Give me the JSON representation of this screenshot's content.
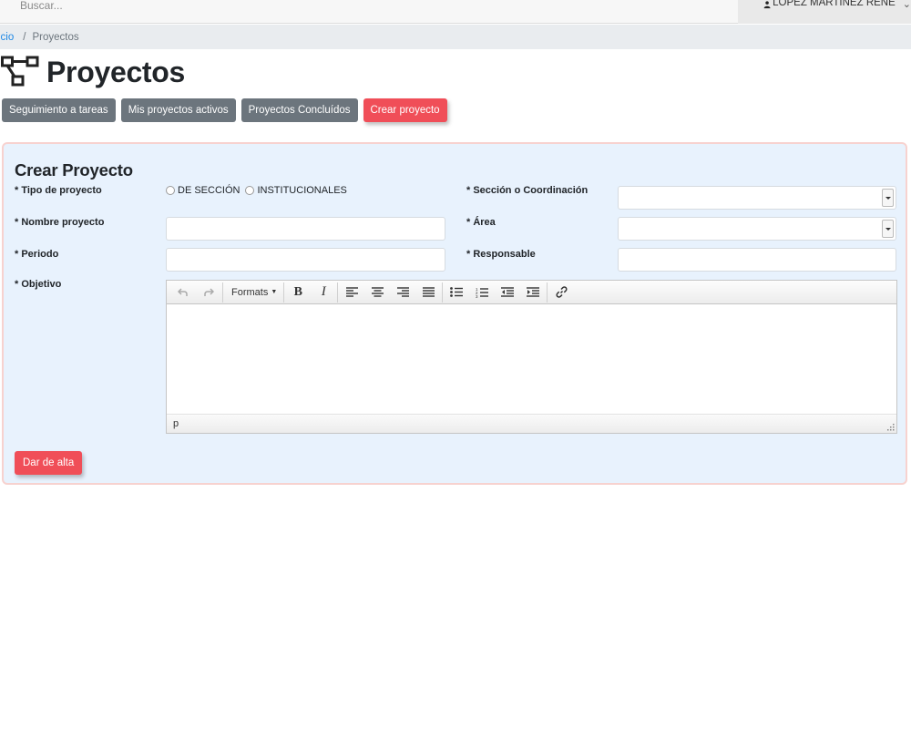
{
  "header": {
    "search_placeholder": "Buscar...",
    "user_name": "LOPEZ MARTINEZ RENE"
  },
  "breadcrumb": {
    "home": "icio",
    "separator": "/",
    "current": "Proyectos"
  },
  "page": {
    "title": "Proyectos"
  },
  "actions": [
    {
      "label": "Seguimiento a tareas",
      "style": "gray"
    },
    {
      "label": "Mis proyectos activos",
      "style": "gray"
    },
    {
      "label": "Proyectos Concluídos",
      "style": "gray"
    },
    {
      "label": "Crear proyecto",
      "style": "red"
    }
  ],
  "form": {
    "title": "Crear Proyecto",
    "labels": {
      "tipo": "* Tipo de proyecto",
      "nombre": "* Nombre proyecto",
      "periodo": "* Periodo",
      "objetivo": "* Objetivo",
      "seccion": "* Sección o Coordinación",
      "area": "* Área",
      "responsable": "* Responsable"
    },
    "radio_options": [
      "DE SECCIÓN",
      "INSTITUCIONALES"
    ],
    "values": {
      "nombre": "",
      "periodo": "",
      "responsable": "",
      "seccion": "",
      "area": ""
    },
    "editor": {
      "formats_label": "Formats",
      "status_path": "p"
    },
    "submit_label": "Dar de alta"
  },
  "colors": {
    "accent_red": "#f04e58",
    "button_gray": "#6c757d",
    "card_bg": "#e8f2fd",
    "link_blue": "#1e88e5"
  }
}
